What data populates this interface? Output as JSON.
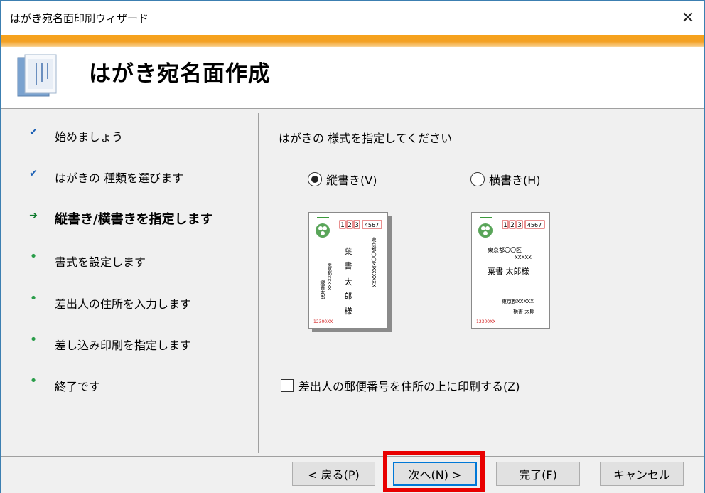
{
  "window": {
    "title": "はがき宛名面印刷ウィザード"
  },
  "header": {
    "title": "はがき宛名面作成"
  },
  "steps": [
    {
      "label": "始めましょう",
      "status": "done"
    },
    {
      "label": "はがきの 種類を選びます",
      "status": "done"
    },
    {
      "label": "縦書き/横書きを指定します",
      "status": "current"
    },
    {
      "label": "書式を設定します",
      "status": "pending"
    },
    {
      "label": "差出人の住所を入力します",
      "status": "pending"
    },
    {
      "label": "差し込み印刷を指定します",
      "status": "pending"
    },
    {
      "label": "終了です",
      "status": "pending"
    }
  ],
  "main": {
    "prompt": "はがきの 様式を指定してください",
    "vertical_label": "縦書き(V)",
    "horizontal_label": "横書き(H)",
    "selected": "vertical",
    "checkbox_label": "差出人の郵便番号を住所の上に印刷する(Z)",
    "checkbox_checked": false,
    "preview": {
      "postal_left": [
        "1",
        "2",
        "3"
      ],
      "postal_right": "4567",
      "vertical": {
        "recipient_address": "東京都〇〇区XXXXXX",
        "recipient_name": [
          "葉",
          "書",
          "太",
          "郎",
          "様"
        ],
        "sender_address": "東京都XXXXX",
        "sender_name": "縦書太郎",
        "sender_postal": "12300XX"
      },
      "horizontal": {
        "recipient_address": "東京都〇〇区",
        "recipient_address2": "XXXXX",
        "recipient_name": "葉書 太郎様",
        "sender_address": "東京都XXXXX",
        "sender_name": "横書 太郎",
        "sender_postal": "12300XX"
      }
    }
  },
  "buttons": {
    "back": "< 戻る(P)",
    "next": "次へ(N) >",
    "finish": "完了(F)",
    "cancel": "キャンセル"
  },
  "colors": {
    "accent": "#f7a21a",
    "current_arrow": "#0d7a2c",
    "check": "#1a5fb4",
    "highlight": "#e80000"
  }
}
